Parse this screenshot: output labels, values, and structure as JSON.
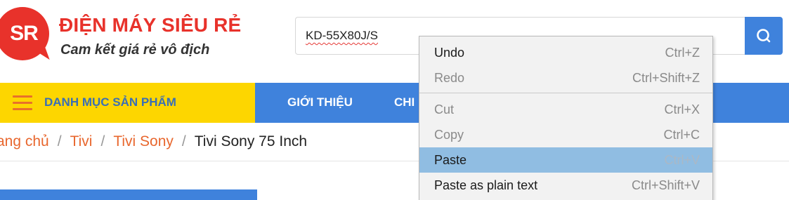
{
  "header": {
    "logo_mark": "SR",
    "brand_name": "ĐIỆN MÁY SIÊU RẺ",
    "slogan": "Cam kết giá rẻ vô địch"
  },
  "search": {
    "value": "KD-55X80J/S"
  },
  "nav": {
    "category_label": "DANH MỤC SẢN PHẨM",
    "links": [
      "GIỚI THIỆU",
      "CHI"
    ]
  },
  "breadcrumb": {
    "items": [
      "rang chủ",
      "Tivi",
      "Tivi Sony"
    ],
    "separator": "/",
    "current": "Tivi Sony 75 Inch"
  },
  "context_menu": {
    "items": [
      {
        "label": "Undo",
        "shortcut": "Ctrl+Z",
        "enabled": true
      },
      {
        "label": "Redo",
        "shortcut": "Ctrl+Shift+Z",
        "enabled": false
      },
      {
        "label": "Cut",
        "shortcut": "Ctrl+X",
        "enabled": false
      },
      {
        "label": "Copy",
        "shortcut": "Ctrl+C",
        "enabled": false
      },
      {
        "label": "Paste",
        "shortcut": "Ctrl+V",
        "enabled": true,
        "highlighted": true
      },
      {
        "label": "Paste as plain text",
        "shortcut": "Ctrl+Shift+V",
        "enabled": true
      }
    ]
  },
  "colors": {
    "brand_red": "#e8322b",
    "nav_blue": "#3f82dc",
    "category_yellow": "#fdd600",
    "breadcrumb_link": "#e8672e",
    "menu_highlight": "#90bde2"
  },
  "icons": {
    "search": "search-icon",
    "menu": "hamburger-icon"
  }
}
